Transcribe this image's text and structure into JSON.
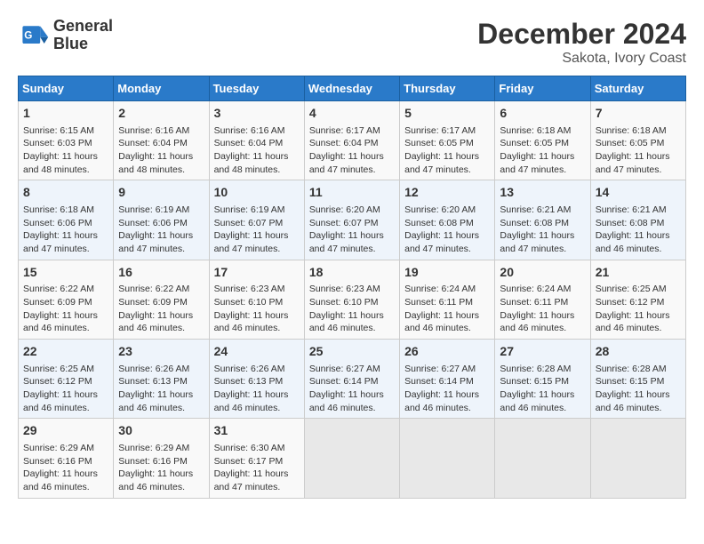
{
  "header": {
    "logo_line1": "General",
    "logo_line2": "Blue",
    "title": "December 2024",
    "subtitle": "Sakota, Ivory Coast"
  },
  "calendar": {
    "days_of_week": [
      "Sunday",
      "Monday",
      "Tuesday",
      "Wednesday",
      "Thursday",
      "Friday",
      "Saturday"
    ],
    "weeks": [
      [
        {
          "day": "",
          "info": ""
        },
        {
          "day": "2",
          "info": "Sunrise: 6:16 AM\nSunset: 6:04 PM\nDaylight: 11 hours\nand 48 minutes."
        },
        {
          "day": "3",
          "info": "Sunrise: 6:16 AM\nSunset: 6:04 PM\nDaylight: 11 hours\nand 48 minutes."
        },
        {
          "day": "4",
          "info": "Sunrise: 6:17 AM\nSunset: 6:04 PM\nDaylight: 11 hours\nand 47 minutes."
        },
        {
          "day": "5",
          "info": "Sunrise: 6:17 AM\nSunset: 6:05 PM\nDaylight: 11 hours\nand 47 minutes."
        },
        {
          "day": "6",
          "info": "Sunrise: 6:18 AM\nSunset: 6:05 PM\nDaylight: 11 hours\nand 47 minutes."
        },
        {
          "day": "7",
          "info": "Sunrise: 6:18 AM\nSunset: 6:05 PM\nDaylight: 11 hours\nand 47 minutes."
        }
      ],
      [
        {
          "day": "8",
          "info": "Sunrise: 6:18 AM\nSunset: 6:06 PM\nDaylight: 11 hours\nand 47 minutes."
        },
        {
          "day": "9",
          "info": "Sunrise: 6:19 AM\nSunset: 6:06 PM\nDaylight: 11 hours\nand 47 minutes."
        },
        {
          "day": "10",
          "info": "Sunrise: 6:19 AM\nSunset: 6:07 PM\nDaylight: 11 hours\nand 47 minutes."
        },
        {
          "day": "11",
          "info": "Sunrise: 6:20 AM\nSunset: 6:07 PM\nDaylight: 11 hours\nand 47 minutes."
        },
        {
          "day": "12",
          "info": "Sunrise: 6:20 AM\nSunset: 6:08 PM\nDaylight: 11 hours\nand 47 minutes."
        },
        {
          "day": "13",
          "info": "Sunrise: 6:21 AM\nSunset: 6:08 PM\nDaylight: 11 hours\nand 47 minutes."
        },
        {
          "day": "14",
          "info": "Sunrise: 6:21 AM\nSunset: 6:08 PM\nDaylight: 11 hours\nand 46 minutes."
        }
      ],
      [
        {
          "day": "15",
          "info": "Sunrise: 6:22 AM\nSunset: 6:09 PM\nDaylight: 11 hours\nand 46 minutes."
        },
        {
          "day": "16",
          "info": "Sunrise: 6:22 AM\nSunset: 6:09 PM\nDaylight: 11 hours\nand 46 minutes."
        },
        {
          "day": "17",
          "info": "Sunrise: 6:23 AM\nSunset: 6:10 PM\nDaylight: 11 hours\nand 46 minutes."
        },
        {
          "day": "18",
          "info": "Sunrise: 6:23 AM\nSunset: 6:10 PM\nDaylight: 11 hours\nand 46 minutes."
        },
        {
          "day": "19",
          "info": "Sunrise: 6:24 AM\nSunset: 6:11 PM\nDaylight: 11 hours\nand 46 minutes."
        },
        {
          "day": "20",
          "info": "Sunrise: 6:24 AM\nSunset: 6:11 PM\nDaylight: 11 hours\nand 46 minutes."
        },
        {
          "day": "21",
          "info": "Sunrise: 6:25 AM\nSunset: 6:12 PM\nDaylight: 11 hours\nand 46 minutes."
        }
      ],
      [
        {
          "day": "22",
          "info": "Sunrise: 6:25 AM\nSunset: 6:12 PM\nDaylight: 11 hours\nand 46 minutes."
        },
        {
          "day": "23",
          "info": "Sunrise: 6:26 AM\nSunset: 6:13 PM\nDaylight: 11 hours\nand 46 minutes."
        },
        {
          "day": "24",
          "info": "Sunrise: 6:26 AM\nSunset: 6:13 PM\nDaylight: 11 hours\nand 46 minutes."
        },
        {
          "day": "25",
          "info": "Sunrise: 6:27 AM\nSunset: 6:14 PM\nDaylight: 11 hours\nand 46 minutes."
        },
        {
          "day": "26",
          "info": "Sunrise: 6:27 AM\nSunset: 6:14 PM\nDaylight: 11 hours\nand 46 minutes."
        },
        {
          "day": "27",
          "info": "Sunrise: 6:28 AM\nSunset: 6:15 PM\nDaylight: 11 hours\nand 46 minutes."
        },
        {
          "day": "28",
          "info": "Sunrise: 6:28 AM\nSunset: 6:15 PM\nDaylight: 11 hours\nand 46 minutes."
        }
      ],
      [
        {
          "day": "29",
          "info": "Sunrise: 6:29 AM\nSunset: 6:16 PM\nDaylight: 11 hours\nand 46 minutes."
        },
        {
          "day": "30",
          "info": "Sunrise: 6:29 AM\nSunset: 6:16 PM\nDaylight: 11 hours\nand 46 minutes."
        },
        {
          "day": "31",
          "info": "Sunrise: 6:30 AM\nSunset: 6:17 PM\nDaylight: 11 hours\nand 47 minutes."
        },
        {
          "day": "",
          "info": ""
        },
        {
          "day": "",
          "info": ""
        },
        {
          "day": "",
          "info": ""
        },
        {
          "day": "",
          "info": ""
        }
      ]
    ],
    "week0_day1": "1",
    "week0_day1_info": "Sunrise: 6:15 AM\nSunset: 6:03 PM\nDaylight: 11 hours\nand 48 minutes."
  }
}
